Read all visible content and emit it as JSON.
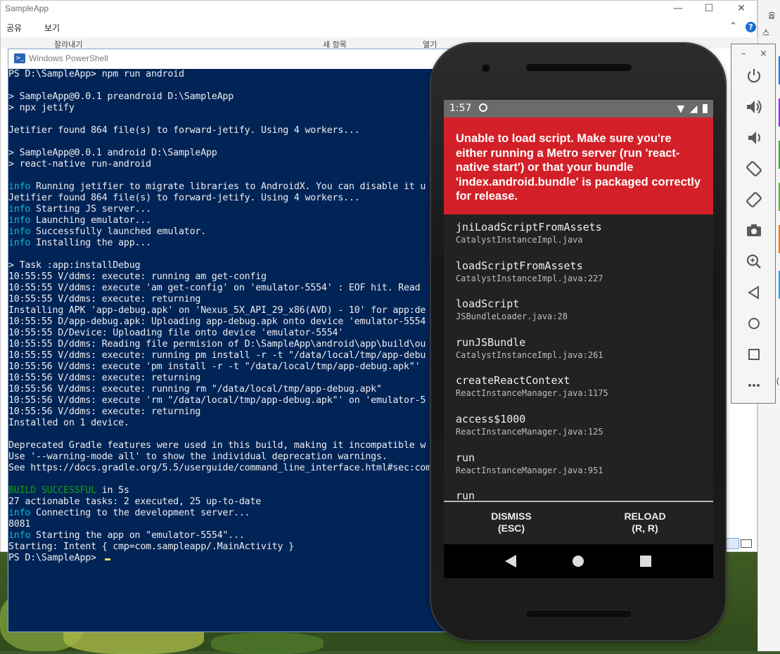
{
  "explorer": {
    "title": "SampleApp",
    "menu_share": "공유",
    "menu_view": "보기",
    "ribbon_cut": "잘라내기",
    "ribbon_new_item": "새 항목",
    "ribbon_open": "열기",
    "help": "?",
    "minimize": "—",
    "maximize": "☐",
    "close": "✕"
  },
  "explorer_right": {
    "text1": "옵",
    "text2": "스",
    "text3": "(",
    "strip_colors": [
      "#1f6fd1",
      "#8a2be2",
      "#3aa33a",
      "#7b3fb5",
      "#c0c0c0",
      "#5fae3b",
      "#e07b20",
      "#3399cc"
    ]
  },
  "powershell": {
    "title": "Windows PowerShell",
    "lines": [
      [
        {
          "t": "PS D:\\SampleApp> npm run android"
        }
      ],
      [
        {
          "t": ""
        }
      ],
      [
        {
          "t": "> SampleApp@0.0.1 preandroid D:\\SampleApp"
        }
      ],
      [
        {
          "t": "> npx jetify"
        }
      ],
      [
        {
          "t": ""
        }
      ],
      [
        {
          "t": "Jetifier found 864 file(s) to forward-jetify. Using 4 workers..."
        }
      ],
      [
        {
          "t": ""
        }
      ],
      [
        {
          "t": "> SampleApp@0.0.1 android D:\\SampleApp"
        }
      ],
      [
        {
          "t": "> react-native run-android"
        }
      ],
      [
        {
          "t": ""
        }
      ],
      [
        {
          "t": "info",
          "c": "info"
        },
        {
          "t": " Running jetifier to migrate libraries to AndroidX. You can disable it u"
        }
      ],
      [
        {
          "t": "Jetifier found 864 file(s) to forward-jetify. Using 4 workers..."
        }
      ],
      [
        {
          "t": "info",
          "c": "info"
        },
        {
          "t": " Starting JS server..."
        }
      ],
      [
        {
          "t": "info",
          "c": "info"
        },
        {
          "t": " Launching emulator..."
        }
      ],
      [
        {
          "t": "info",
          "c": "info"
        },
        {
          "t": " Successfully launched emulator."
        }
      ],
      [
        {
          "t": "info",
          "c": "info"
        },
        {
          "t": " Installing the app..."
        }
      ],
      [
        {
          "t": ""
        }
      ],
      [
        {
          "t": "> Task :app:installDebug"
        }
      ],
      [
        {
          "t": "10:55:55 V/ddms: execute: running am get-config"
        }
      ],
      [
        {
          "t": "10:55:55 V/ddms: execute 'am get-config' on 'emulator-5554' : EOF hit. Read"
        }
      ],
      [
        {
          "t": "10:55:55 V/ddms: execute: returning"
        }
      ],
      [
        {
          "t": "Installing APK 'app-debug.apk' on 'Nexus_5X_API_29_x86(AVD) - 10' for app:de"
        }
      ],
      [
        {
          "t": "10:55:55 D/app-debug.apk: Uploading app-debug.apk onto device 'emulator-5554"
        }
      ],
      [
        {
          "t": "10:55:55 D/Device: Uploading file onto device 'emulator-5554'"
        }
      ],
      [
        {
          "t": "10:55:55 D/ddms: Reading file permision of D:\\SampleApp\\android\\app\\build\\ou"
        }
      ],
      [
        {
          "t": "10:55:55 V/ddms: execute: running pm install -r -t \"/data/local/tmp/app-debu"
        }
      ],
      [
        {
          "t": "10:55:56 V/ddms: execute 'pm install -r -t \"/data/local/tmp/app-debug.apk\"'"
        }
      ],
      [
        {
          "t": "10:55:56 V/ddms: execute: returning"
        }
      ],
      [
        {
          "t": "10:55:56 V/ddms: execute: running rm \"/data/local/tmp/app-debug.apk\""
        }
      ],
      [
        {
          "t": "10:55:56 V/ddms: execute 'rm \"/data/local/tmp/app-debug.apk\"' on 'emulator-5"
        }
      ],
      [
        {
          "t": "10:55:56 V/ddms: execute: returning"
        }
      ],
      [
        {
          "t": "Installed on 1 device."
        }
      ],
      [
        {
          "t": ""
        }
      ],
      [
        {
          "t": "Deprecated Gradle features were used in this build, making it incompatible w"
        }
      ],
      [
        {
          "t": "Use '--warning-mode all' to show the individual deprecation warnings."
        }
      ],
      [
        {
          "t": "See https://docs.gradle.org/5.5/userguide/command_line_interface.html#sec:com"
        }
      ],
      [
        {
          "t": ""
        }
      ],
      [
        {
          "t": "BUILD SUCCESSFUL",
          "c": "ok"
        },
        {
          "t": " in 5s"
        }
      ],
      [
        {
          "t": "27 actionable tasks: 2 executed, 25 up-to-date"
        }
      ],
      [
        {
          "t": "info",
          "c": "info"
        },
        {
          "t": " Connecting to the development server..."
        }
      ],
      [
        {
          "t": "8081"
        }
      ],
      [
        {
          "t": "info",
          "c": "info"
        },
        {
          "t": " Starting the app on \"emulator-5554\"..."
        }
      ],
      [
        {
          "t": "Starting: Intent { cmp=com.sampleapp/.MainActivity }"
        }
      ],
      [
        {
          "t": "PS D:\\SampleApp> "
        }
      ]
    ]
  },
  "phone": {
    "status_time": "1:57",
    "error_message": "Unable to load script. Make sure you're either running a Metro server (run 'react-native start') or that your bundle 'index.android.bundle' is packaged correctly for release.",
    "stack": [
      {
        "fn": "jniLoadScriptFromAssets",
        "loc": "CatalystInstanceImpl.java"
      },
      {
        "fn": "loadScriptFromAssets",
        "loc": "CatalystInstanceImpl.java:227"
      },
      {
        "fn": "loadScript",
        "loc": "JSBundleLoader.java:28"
      },
      {
        "fn": "runJSBundle",
        "loc": "CatalystInstanceImpl.java:261"
      },
      {
        "fn": "createReactContext",
        "loc": "ReactInstanceManager.java:1175"
      },
      {
        "fn": "access$1000",
        "loc": "ReactInstanceManager.java:125"
      },
      {
        "fn": "run",
        "loc": "ReactInstanceManager.java:951"
      },
      {
        "fn": "run",
        "loc": ""
      }
    ],
    "dismiss_label": "DISMISS",
    "dismiss_key": "(ESC)",
    "reload_label": "RELOAD",
    "reload_key": "(R, R)",
    "error_color": "#d32028"
  },
  "emulator_toolbar": {
    "minimize": "–",
    "close": "×",
    "tools": [
      "power-icon",
      "volume-up-icon",
      "volume-down-icon",
      "rotate-left-icon",
      "rotate-right-icon",
      "camera-icon",
      "zoom-icon",
      "back-icon",
      "home-icon",
      "overview-icon",
      "more-icon"
    ]
  }
}
